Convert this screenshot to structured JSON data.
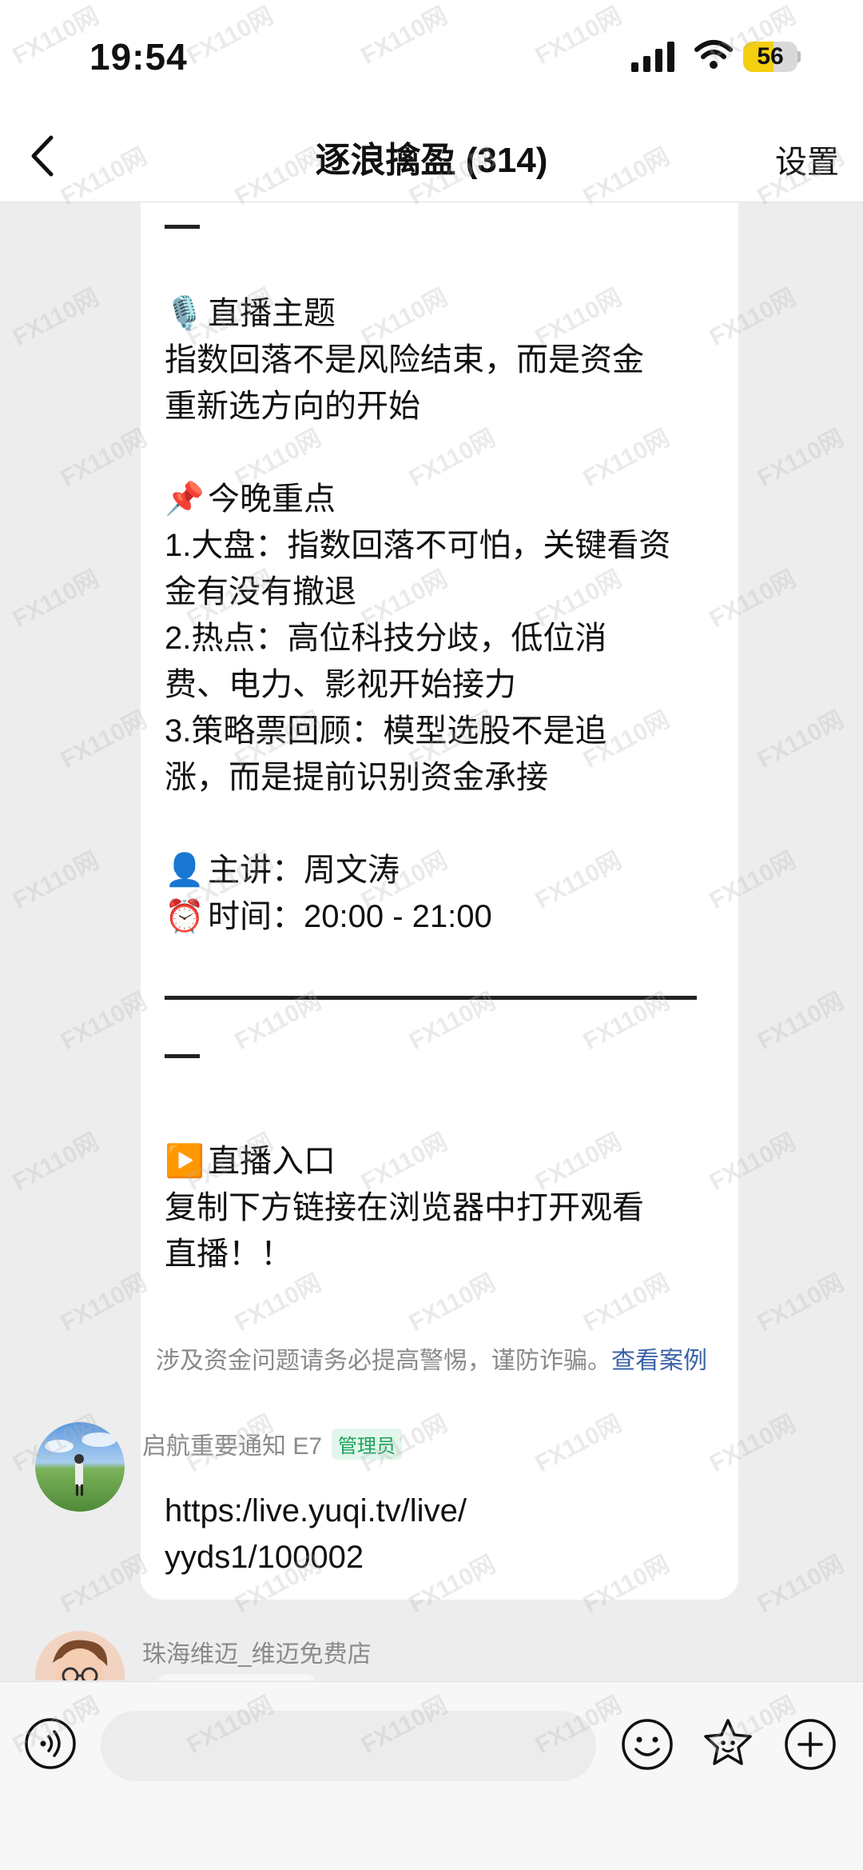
{
  "status_bar": {
    "time": "19:54",
    "battery_percent": 56,
    "battery_label": "56"
  },
  "nav": {
    "title": "逐浪擒盈 (314)",
    "settings_label": "设置"
  },
  "message_main": {
    "top_dash": "—",
    "topic_emoji": "🎙️",
    "topic_heading": "直播主题",
    "topic_line1": "指数回落不是风险结束，而是资金",
    "topic_line2": "重新选方向的开始",
    "focus_emoji": "📌",
    "focus_heading": "今晚重点",
    "focus_line1": "1.大盘：指数回落不可怕，关键看资",
    "focus_line2": "金有没有撤退",
    "focus_line3": "2.热点：高位科技分歧，低位消",
    "focus_line4": "费、电力、影视开始接力",
    "focus_line5": "3.策略票回顾：模型选股不是追",
    "focus_line6": "涨，而是提前识别资金承接",
    "speaker_emoji": "👤",
    "speaker": "主讲：周文涛",
    "time_emoji": "⏰",
    "time": "时间：20:00 - 21:00",
    "entry_emoji": "▶️",
    "entry_heading": "直播入口",
    "entry_line1": "复制下方链接在浏览器中打开观看",
    "entry_line2": "直播！！"
  },
  "warning": {
    "text": "涉及资金问题请务必提高警惕，谨防诈骗。",
    "link": "查看案例"
  },
  "message_link": {
    "sender": "启航重要通知 E7",
    "badge": "管理员",
    "line1": "https:/live.yuqi.tv/live/",
    "line2": "yyds1/100002"
  },
  "message_next": {
    "sender": "珠海维迈_维迈免费店"
  },
  "input_bar": {
    "value": "",
    "placeholder": ""
  },
  "watermark": {
    "text": "FX110网"
  },
  "colors": {
    "link": "#3b63a8",
    "admin_badge": "#1aa35a",
    "battery": "#f5cf10",
    "background": "#ededed"
  }
}
